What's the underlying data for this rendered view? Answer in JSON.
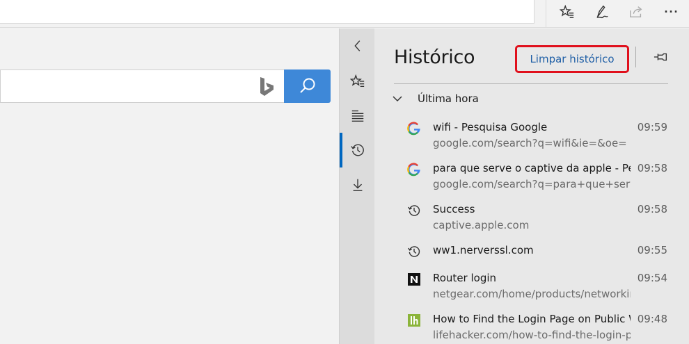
{
  "toolbar": {
    "icons": [
      "favorites-star-icon",
      "pen-icon",
      "share-icon",
      "more-icon"
    ],
    "more_label": "···"
  },
  "hub": {
    "rail": [
      "collapse-chevron-icon",
      "favorites-icon",
      "reading-list-icon",
      "history-icon",
      "downloads-icon"
    ],
    "active": "history"
  },
  "history": {
    "title": "Histórico",
    "clear_label": "Limpar histórico",
    "group_label": "Última hora",
    "entries": [
      {
        "icon": "google-icon",
        "title": "wifi - Pesquisa Google",
        "url": "google.com/search?q=wifi&ie=&oe=",
        "time": "09:59"
      },
      {
        "icon": "google-icon",
        "title": "para que serve o captive da apple - Pesquisa Google",
        "url": "google.com/search?q=para+que+serve+o+captive",
        "time": "09:58"
      },
      {
        "icon": "history-icon",
        "title": "Success",
        "url": "captive.apple.com",
        "time": "09:58"
      },
      {
        "icon": "history-icon",
        "title": "ww1.nerverssl.com",
        "url": "",
        "time": "09:55"
      },
      {
        "icon": "netgear-icon",
        "title": "Router login",
        "url": "netgear.com/home/products/networking",
        "time": "09:54"
      },
      {
        "icon": "lifehacker-icon",
        "title": "How to Find the Login Page on Public Wi-Fi",
        "url": "lifehacker.com/how-to-find-the-login-page",
        "time": "09:48"
      }
    ]
  },
  "colors": {
    "accent": "#0067c0",
    "search_button": "#3e88d8",
    "highlight_box": "#e0101c",
    "link": "#1f5fa6"
  }
}
